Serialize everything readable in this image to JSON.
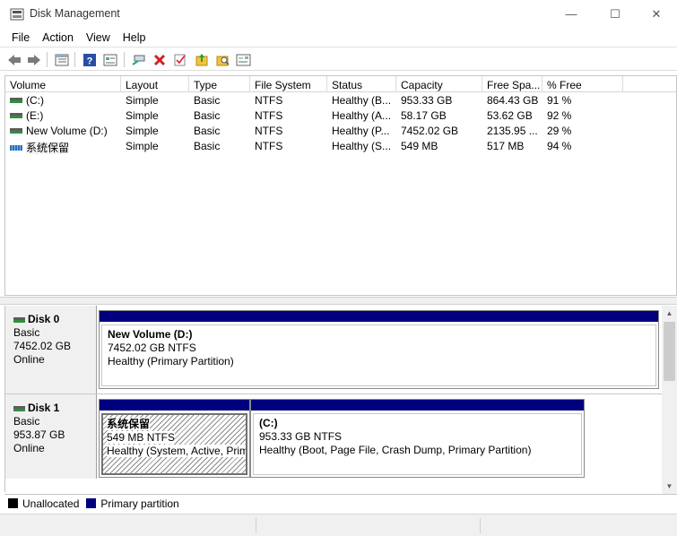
{
  "window": {
    "title": "Disk Management",
    "controls": {
      "minimize": "—",
      "maximize": "☐",
      "close": "✕"
    }
  },
  "menu": [
    "File",
    "Action",
    "View",
    "Help"
  ],
  "toolbar": {
    "icons": [
      "back-icon",
      "forward-icon",
      "list-view-icon",
      "help-icon",
      "properties-icon",
      "connect-icon",
      "delete-icon",
      "check-icon",
      "open-folder-icon",
      "explore-icon",
      "settings-icon"
    ],
    "colors": {
      "delete": "#d22020",
      "help": "#2a4da8",
      "folder": "#f2c43d"
    }
  },
  "volume_list": {
    "columns": [
      "Volume",
      "Layout",
      "Type",
      "File System",
      "Status",
      "Capacity",
      "Free Spa...",
      "% Free"
    ],
    "rows": [
      {
        "volume": "(C:)",
        "layout": "Simple",
        "type": "Basic",
        "fs": "NTFS",
        "status": "Healthy (B...",
        "capacity": "953.33 GB",
        "free": "864.43 GB",
        "pct": "91 %",
        "icon": "drive-icon"
      },
      {
        "volume": "(E:)",
        "layout": "Simple",
        "type": "Basic",
        "fs": "NTFS",
        "status": "Healthy (A...",
        "capacity": "58.17 GB",
        "free": "53.62 GB",
        "pct": "92 %",
        "icon": "drive-icon"
      },
      {
        "volume": "New Volume (D:)",
        "layout": "Simple",
        "type": "Basic",
        "fs": "NTFS",
        "status": "Healthy (P...",
        "capacity": "7452.02 GB",
        "free": "2135.95 ...",
        "pct": "29 %",
        "icon": "drive-icon"
      },
      {
        "volume": "系统保留",
        "layout": "Simple",
        "type": "Basic",
        "fs": "NTFS",
        "status": "Healthy (S...",
        "capacity": "549 MB",
        "free": "517 MB",
        "pct": "94 %",
        "icon": "system-drive-icon"
      }
    ]
  },
  "disks": [
    {
      "name": "Disk 0",
      "kind": "Basic",
      "size": "7452.02 GB",
      "state": "Online",
      "partitions": [
        {
          "name": "New Volume  (D:)",
          "size_fs": "7452.02 GB NTFS",
          "status": "Healthy (Primary Partition)",
          "hatched": false
        }
      ]
    },
    {
      "name": "Disk 1",
      "kind": "Basic",
      "size": "953.87 GB",
      "state": "Online",
      "partitions": [
        {
          "name": "系统保留",
          "size_fs": "549 MB NTFS",
          "status": "Healthy (System, Active, Prim",
          "hatched": true
        },
        {
          "name": "(C:)",
          "size_fs": "953.33 GB NTFS",
          "status": "Healthy (Boot, Page File, Crash Dump, Primary Partition)",
          "hatched": false
        }
      ]
    }
  ],
  "legend": [
    {
      "label": "Unallocated",
      "color": "#000000"
    },
    {
      "label": "Primary partition",
      "color": "#00007f"
    }
  ]
}
